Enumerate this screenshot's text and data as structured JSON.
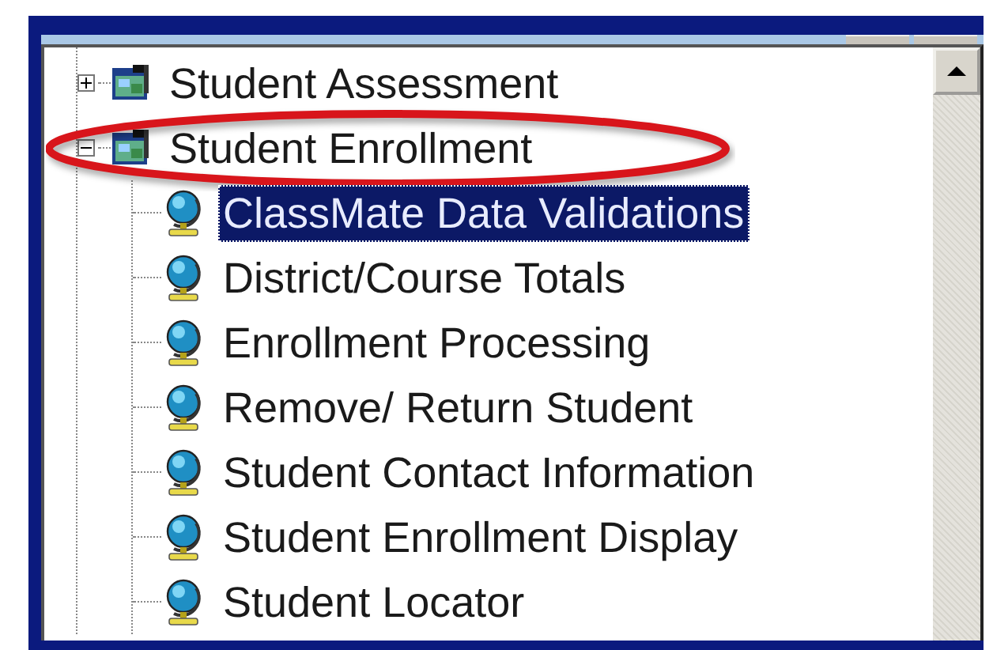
{
  "tree": {
    "items": [
      {
        "label": "Student Assessment",
        "expanded": false,
        "selected": false,
        "circled": false
      },
      {
        "label": "Student Enrollment",
        "expanded": true,
        "selected": false,
        "circled": true,
        "children": [
          {
            "label": "ClassMate Data Validations",
            "selected": true
          },
          {
            "label": "District/Course Totals",
            "selected": false
          },
          {
            "label": "Enrollment Processing",
            "selected": false
          },
          {
            "label": "Remove/ Return Student",
            "selected": false
          },
          {
            "label": "Student Contact Information",
            "selected": false
          },
          {
            "label": "Student Enrollment Display",
            "selected": false
          },
          {
            "label": "Student Locator",
            "selected": false
          }
        ]
      }
    ]
  }
}
